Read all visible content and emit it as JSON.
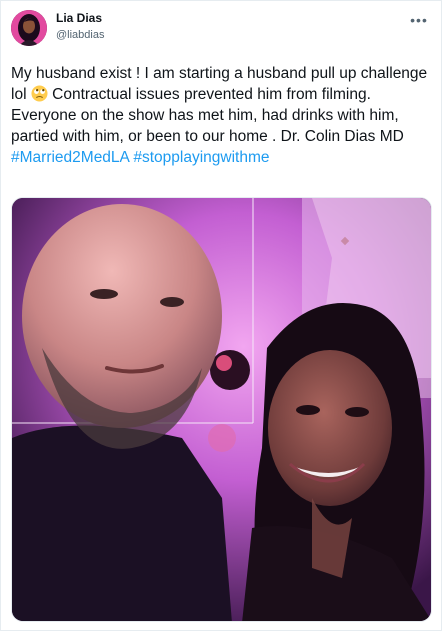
{
  "author": {
    "display_name": "Lia Dias",
    "handle": "@liabdias"
  },
  "more_icon": "more-horizontal-icon",
  "tweet": {
    "text_part1": "My husband exist ! I am starting a husband pull up challenge lol ",
    "emoji": "face-with-rolling-eyes",
    "text_part2": " Contractual issues prevented him from filming. Everyone on the show has met him, had drinks with him, partied with him, or been to our home . Dr. Colin Dias MD ",
    "hashtag1": "#Married2MedLA",
    "hashtag2": "#stopplayingwithme"
  },
  "colors": {
    "link": "#1d9bf0",
    "text": "#0f1419",
    "secondary": "#536471"
  }
}
